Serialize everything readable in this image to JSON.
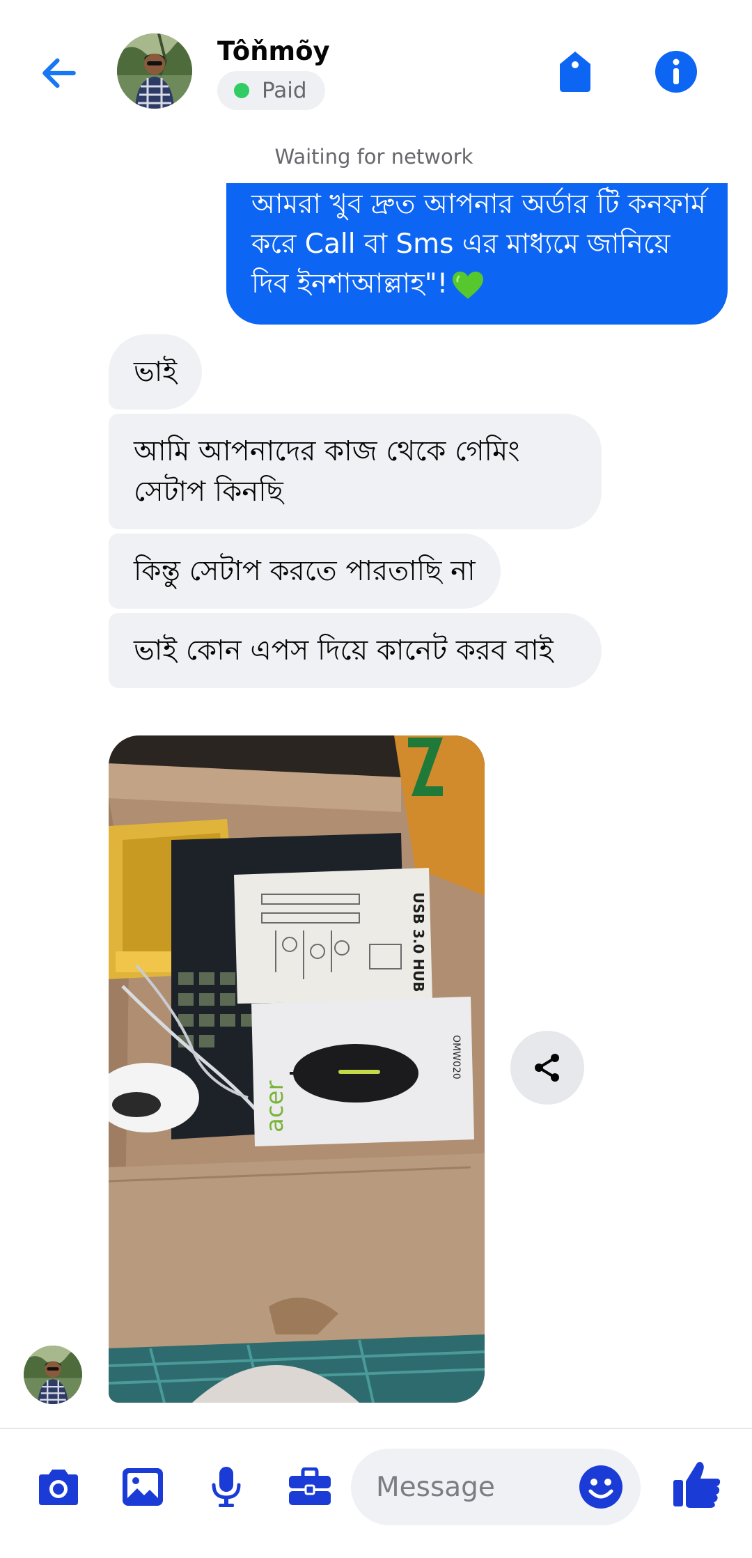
{
  "colors": {
    "accent": "#0d65f4",
    "icon_blue": "#1a3bd6",
    "online": "#31cc63",
    "incoming_bubble": "#f0f1f4"
  },
  "header": {
    "back_icon": "arrow-left-icon",
    "contact_name": "Tôňmõy",
    "status_label": "Paid",
    "tag_icon": "tag-icon",
    "info_icon": "info-icon"
  },
  "network_status": "Waiting for network",
  "messages": [
    {
      "direction": "outgoing",
      "text": "আমরা খুব দ্রুত আপনার অর্ডার টি কনফার্ম করে Call বা Sms এর মাধ্যমে জানিয়ে দিব ইনশাআল্লাহ\"!",
      "emoji": "green-heart-icon"
    },
    {
      "direction": "incoming",
      "text": "ভাই"
    },
    {
      "direction": "incoming",
      "text": "আমি আপনাদের কাজ থেকে গেমিং সেটাপ কিনছি"
    },
    {
      "direction": "incoming",
      "text": "কিন্তু সেটাপ করতে পারতাছি না"
    },
    {
      "direction": "incoming",
      "text": "ভাই কোন এপস দিয়ে কানেট করব বাই"
    },
    {
      "direction": "incoming",
      "type": "photo",
      "box_label": "USB 3.0 HUB",
      "mouse_brand": "acer",
      "mouse_model": "OMW020"
    }
  ],
  "actions": {
    "share_icon": "share-icon"
  },
  "composer": {
    "tools": [
      "camera-icon",
      "gallery-icon",
      "microphone-icon",
      "briefcase-icon"
    ],
    "placeholder": "Message",
    "value": "",
    "emoji_icon": "smiley-icon",
    "send_icon": "thumbs-up-icon"
  }
}
